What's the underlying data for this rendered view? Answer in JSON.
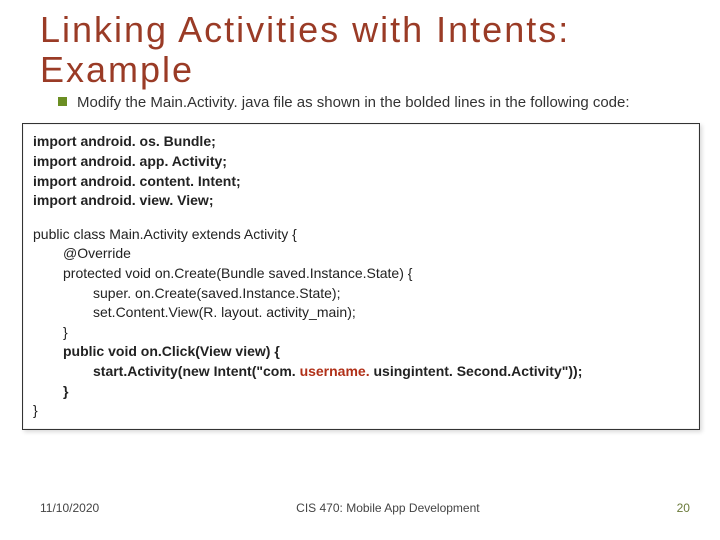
{
  "title": "Linking  Activities  with  Intents: Example",
  "bullet": "Modify the Main.Activity. java file as shown in the bolded lines in the following code:",
  "code": {
    "l1": "import android. os. Bundle;",
    "l2": "import android. app. Activity;",
    "l3": "import android. content. Intent;",
    "l4": "import android. view. View;",
    "l5": "public class Main.Activity extends Activity {",
    "l6": "@Override",
    "l7": "protected void on.Create(Bundle saved.Instance.State) {",
    "l8": "super. on.Create(saved.Instance.State);",
    "l9": "set.Content.View(R. layout. activity_main);",
    "l10": "}",
    "l11": "public void on.Click(View view) {",
    "l12a": "start.Activity(new Intent(\"com. ",
    "l12b": "username.",
    "l12c": " usingintent. Second.Activity\"));",
    "l13": "}",
    "l14": "}"
  },
  "footer": {
    "date": "11/10/2020",
    "course": "CIS 470: Mobile App Development",
    "page": "20"
  }
}
